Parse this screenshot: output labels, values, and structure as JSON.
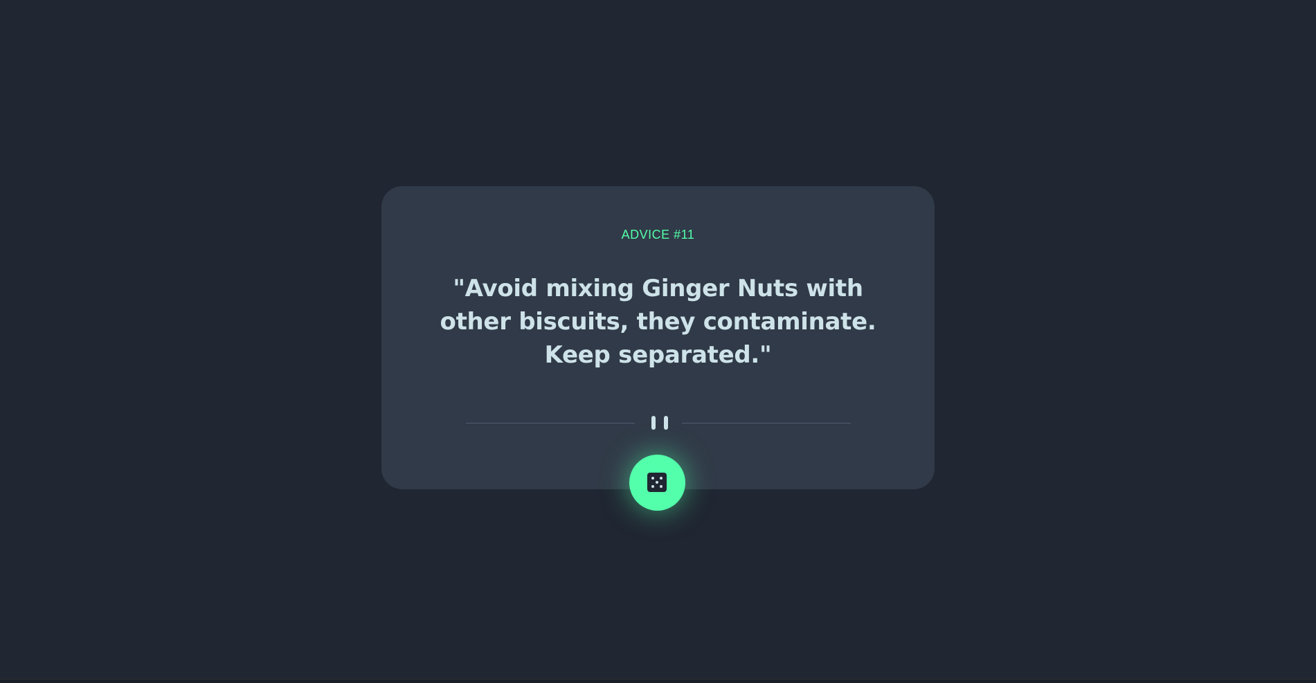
{
  "advice": {
    "label": "ADVICE #11",
    "quote": "\"Avoid mixing Ginger Nuts with other biscuits, they contaminate. Keep separated.\""
  },
  "divider": {
    "icon": "pause-icon"
  },
  "generate_button": {
    "icon": "dice-icon"
  },
  "colors": {
    "background": "#202632",
    "card": "#313a48",
    "accent": "#53ffaa",
    "text": "#cee3e9",
    "divider": "#4f5d74"
  }
}
